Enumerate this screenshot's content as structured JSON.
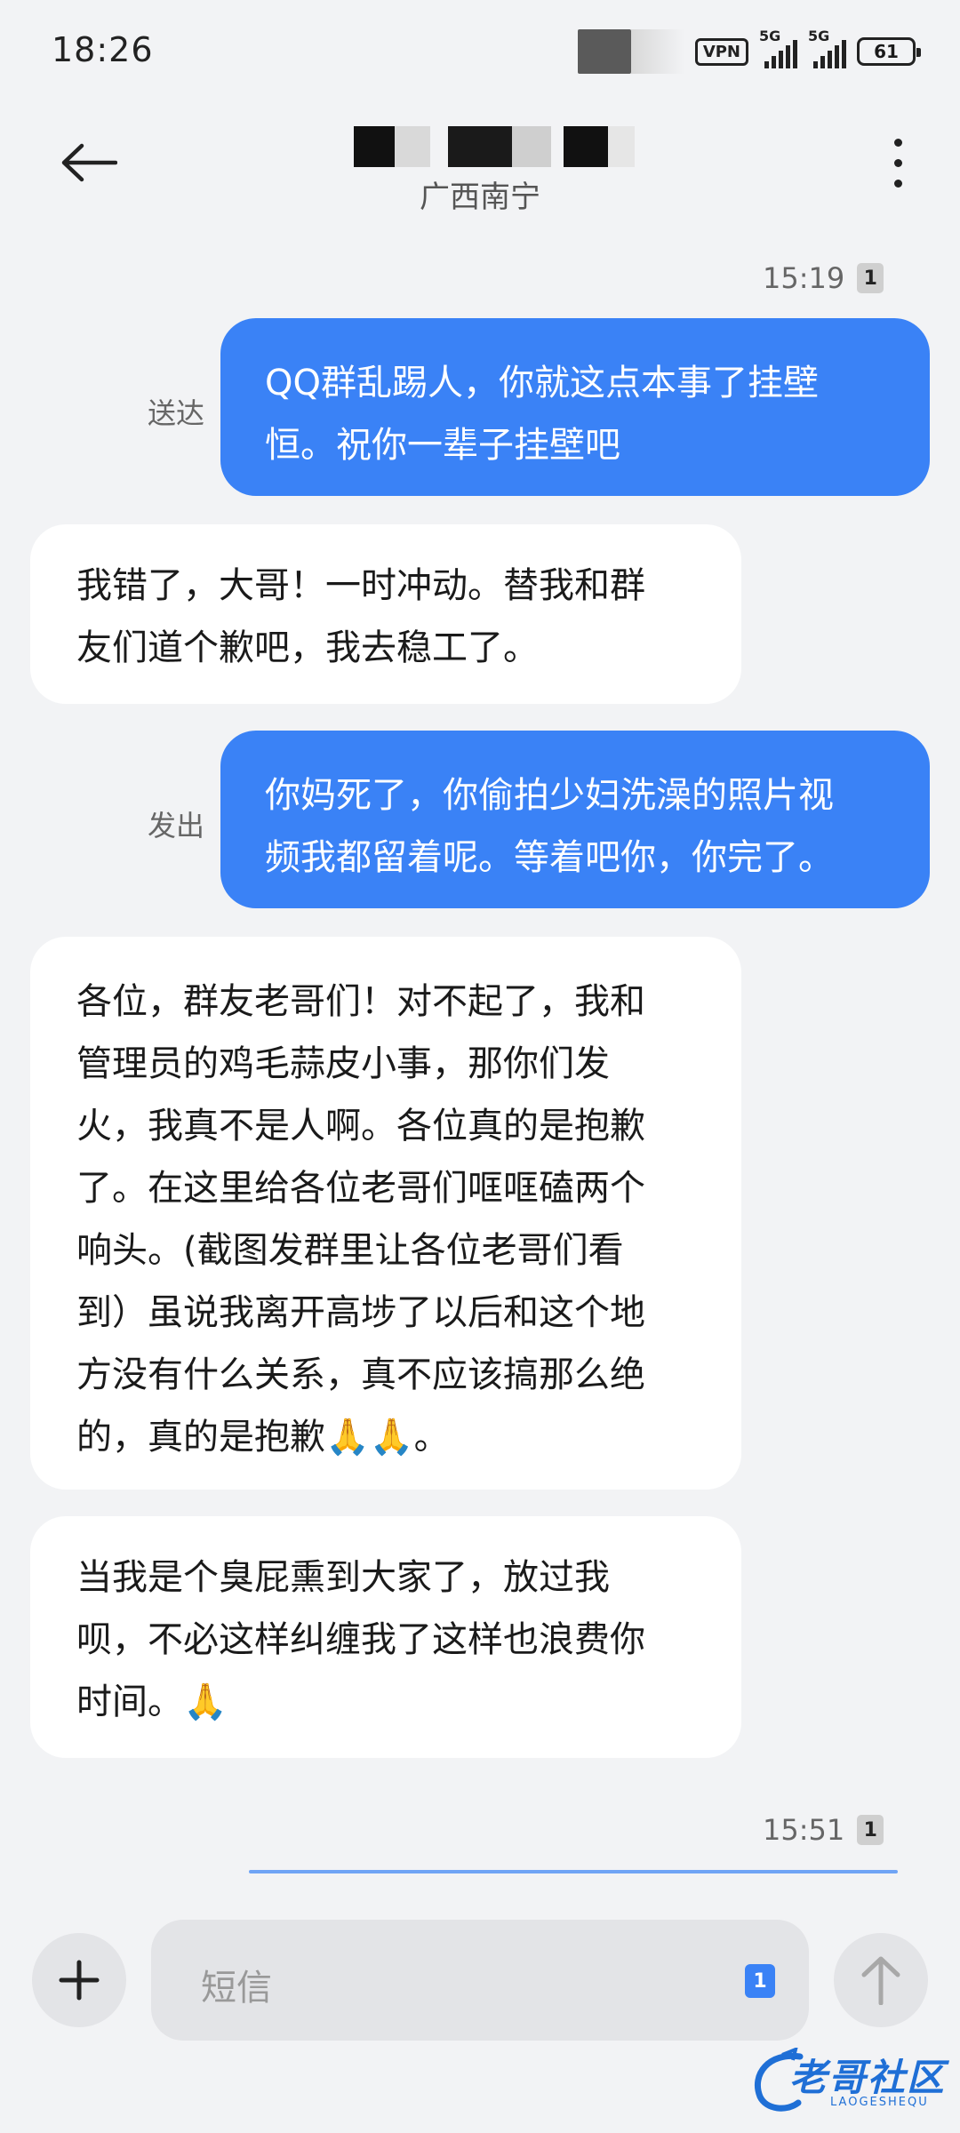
{
  "status_bar": {
    "time": "18:26",
    "vpn": "VPN",
    "network_1": "5G",
    "network_2": "5G",
    "battery": "61"
  },
  "header": {
    "location": "广西南宁"
  },
  "messages": [
    {
      "type": "timestamp",
      "time": "15:19",
      "sim": "1"
    },
    {
      "type": "outgoing",
      "status": "送达",
      "text": "QQ群乱踢人，你就这点本事了挂壁\n恒。祝你一辈子挂壁吧"
    },
    {
      "type": "incoming",
      "text": "我错了，大哥！一时冲动。替我和群\n友们道个歉吧，我去稳工了。"
    },
    {
      "type": "outgoing",
      "status": "发出",
      "text": "你妈死了，你偷拍少妇洗澡的照片视\n频我都留着呢。等着吧你，你完了。"
    },
    {
      "type": "incoming",
      "text": "各位，群友老哥们！对不起了，我和\n管理员的鸡毛蒜皮小事，那你们发\n火，我真不是人啊。各位真的是抱歉\n了。在这里给各位老哥们哐哐磕两个\n响头。(截图发群里让各位老哥们看\n到）虽说我离开高埗了以后和这个地\n方没有什么关系，真不应该搞那么绝\n的，真的是抱歉🙏🙏。"
    },
    {
      "type": "incoming",
      "text": "当我是个臭屁熏到大家了，放过我\n呗，不必这样纠缠我了这样也浪费你\n时间。🙏"
    },
    {
      "type": "timestamp",
      "time": "15:51",
      "sim": "1"
    }
  ],
  "input": {
    "placeholder": "短信",
    "sim": "1"
  },
  "watermark": {
    "text": "老哥社区",
    "sub": "LAOGESHEQU"
  },
  "colors": {
    "background": "#f2f3f5",
    "outgoing_bubble": "#3a82f6",
    "incoming_bubble": "#ffffff"
  }
}
